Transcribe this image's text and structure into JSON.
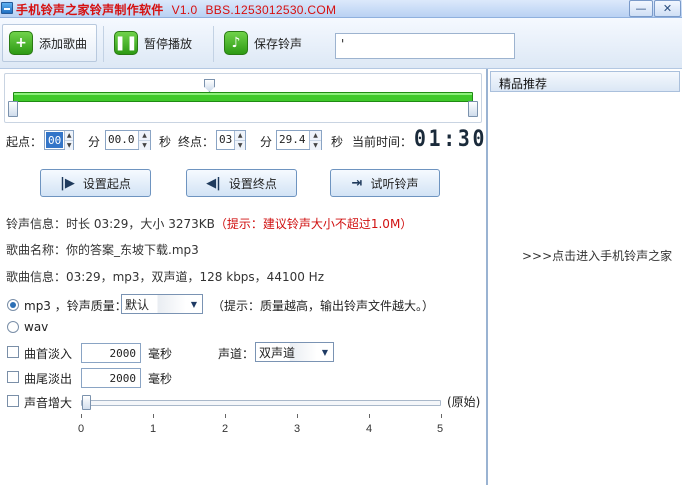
{
  "window": {
    "title": "手机铃声之家铃声制作软件",
    "version": "V1.0",
    "bbs": "BBS.1253012530.COM",
    "min_label": "—",
    "close_label": "✕"
  },
  "toolbar": {
    "add_song": "添加歌曲",
    "pause": "暂停播放",
    "save": "保存铃声",
    "input_value": "'"
  },
  "time_row": {
    "start_label": "起点：",
    "start_min": "00",
    "min_unit": "分",
    "start_sec": "00.0",
    "sec_unit": "秒",
    "end_label": "终点：",
    "end_min": "03",
    "end_sec": "29.4",
    "current_label": "当前时间：",
    "current_time": "01:30"
  },
  "actions": {
    "set_start": "设置起点",
    "set_end": "设置终点",
    "preview": "试听铃声"
  },
  "info": {
    "ringtone_prefix": "铃声信息：时长 03:29，大小 3273KB",
    "ringtone_warning": "（提示：建议铃声大小不超过1.0M）",
    "song_name": "歌曲名称：你的答案_东坡下载.mp3",
    "song_info": "歌曲信息：03:29，mp3，双声道，128 kbps，44100 Hz"
  },
  "format": {
    "mp3_label": "mp3 ，铃声质量：",
    "quality_value": "默认",
    "quality_hint": "（提示：质量越高，输出铃声文件越大。）",
    "wav_label": "wav",
    "mp3_selected": true
  },
  "effects": {
    "fade_in_label": "曲首淡入",
    "fade_in_value": "2000",
    "fade_out_label": "曲尾淡出",
    "fade_out_value": "2000",
    "ms_unit": "毫秒",
    "channel_label": "声道：",
    "channel_value": "双声道",
    "volume_label": "声音增大",
    "volume_status": "(原始)",
    "volume_level": 0,
    "volume_ticks": [
      "0",
      "1",
      "2",
      "3",
      "4",
      "5"
    ]
  },
  "sidebar": {
    "header": "精品推荐",
    "link": ">>>点击进入手机铃声之家"
  },
  "colors": {
    "progress_green": "#3fc92a",
    "warning_red": "#d01010",
    "title_red": "#d61010"
  }
}
